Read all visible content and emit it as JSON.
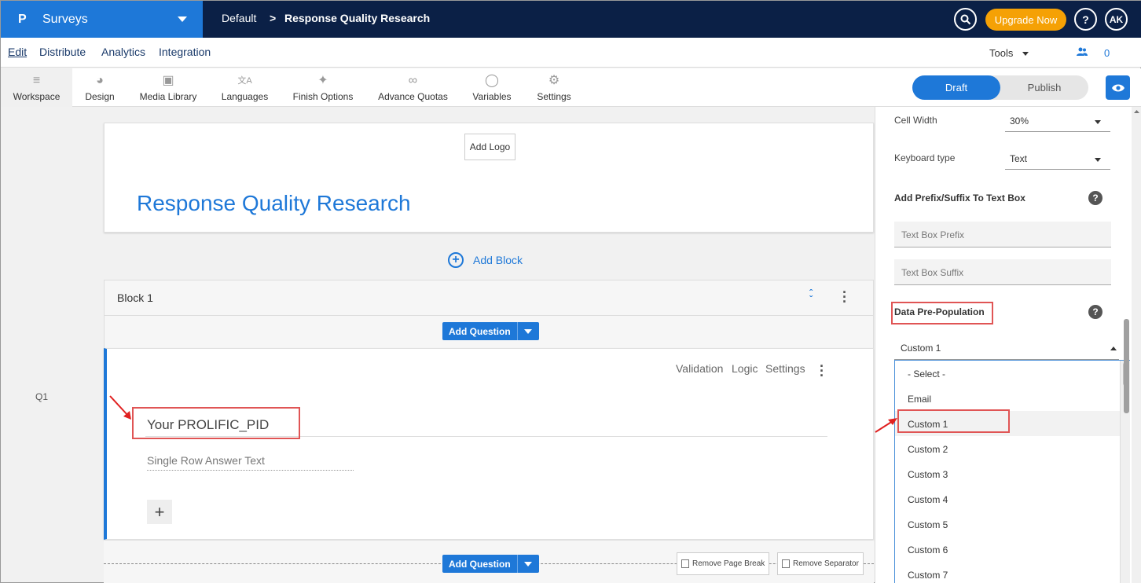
{
  "app": {
    "logo_letter": "P",
    "name": "Surveys",
    "breadcrumb": [
      "Default",
      "Response Quality Research"
    ],
    "breadcrumb_sep": ">",
    "upgrade_label": "Upgrade Now",
    "help_label": "?",
    "user_initials": "AK",
    "brand_color": "#1e78d8",
    "nav_color": "#0b2046",
    "upgrade_color": "#f5a105"
  },
  "menu": {
    "items": [
      "Edit",
      "Distribute",
      "Analytics",
      "Integration"
    ],
    "tools_label": "Tools",
    "collaborators_count": "0"
  },
  "toolbar": {
    "items": [
      {
        "label": "Workspace",
        "icon": "workspace-icon"
      },
      {
        "label": "Design",
        "icon": "palette-icon"
      },
      {
        "label": "Media Library",
        "icon": "image-icon"
      },
      {
        "label": "Languages",
        "icon": "translate-icon"
      },
      {
        "label": "Finish Options",
        "icon": "wand-icon"
      },
      {
        "label": "Advance Quotas",
        "icon": "link-icon"
      },
      {
        "label": "Variables",
        "icon": "tag-icon"
      },
      {
        "label": "Settings",
        "icon": "gear-icon"
      }
    ],
    "draft_label": "Draft",
    "publish_label": "Publish"
  },
  "survey": {
    "add_logo_label": "Add Logo",
    "title": "Response Quality Research",
    "add_block_label": "Add Block"
  },
  "block": {
    "title": "Block 1",
    "add_question_label": "Add Question"
  },
  "question": {
    "number": "Q1",
    "actions": [
      "Validation",
      "Logic",
      "Settings"
    ],
    "text": "Your PROLIFIC_PID",
    "answer_placeholder": "Single Row Answer Text",
    "add_label": "+"
  },
  "footer": {
    "add_question_label": "Add Question",
    "remove_page_break": "Remove Page Break",
    "remove_separator": "Remove Separator"
  },
  "panel": {
    "cell_width_label": "Cell Width",
    "cell_width_value": "30%",
    "keyboard_type_label": "Keyboard type",
    "keyboard_type_value": "Text",
    "prefix_suffix_heading": "Add Prefix/Suffix To Text Box",
    "prefix_placeholder": "Text Box Prefix",
    "suffix_placeholder": "Text Box Suffix",
    "data_prepopulation_heading": "Data Pre-Population",
    "data_prepopulation_value": "Custom 1",
    "options": [
      "- Select -",
      "Email",
      "Custom 1",
      "Custom 2",
      "Custom 3",
      "Custom 4",
      "Custom 5",
      "Custom 6",
      "Custom 7"
    ],
    "selected_option": "Custom 1",
    "highlight_color": "#e05555"
  }
}
